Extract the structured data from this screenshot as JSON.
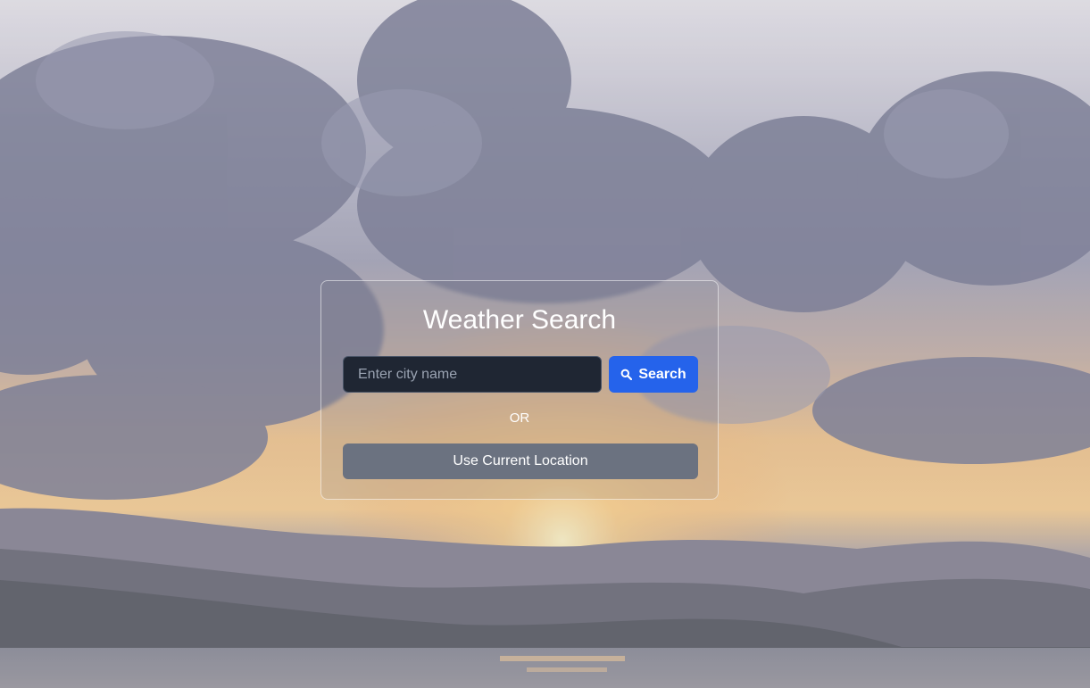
{
  "app": {
    "title": "Weather Search"
  },
  "search": {
    "placeholder": "Enter city name",
    "value": "",
    "button_label": "Search",
    "button_icon": "search-icon"
  },
  "divider": {
    "text": "OR"
  },
  "location": {
    "button_label": "Use Current Location"
  },
  "colors": {
    "primary_button": "#2563eb",
    "secondary_button": "#6b7280",
    "input_background": "#1f2633",
    "text": "#ffffff"
  }
}
